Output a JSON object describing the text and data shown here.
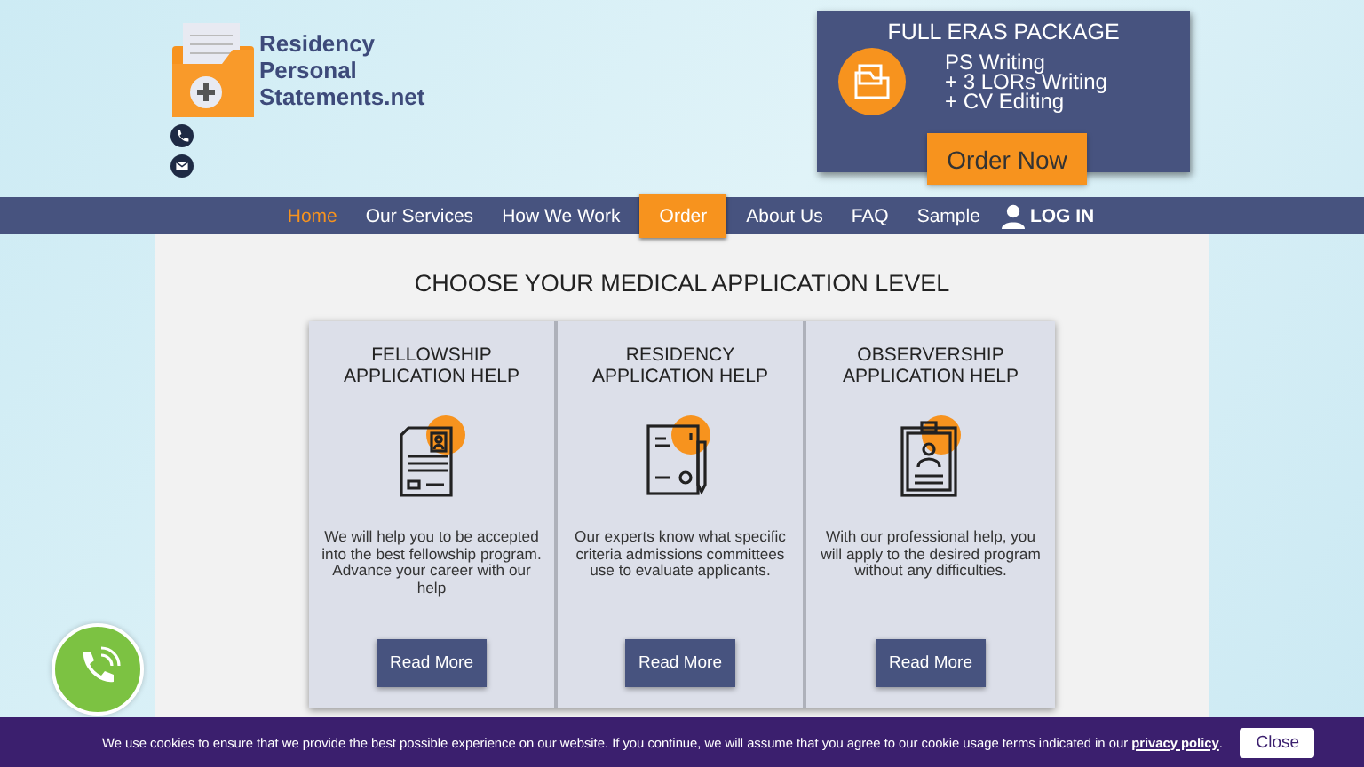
{
  "logo": {
    "lines": [
      "Residency",
      "Personal",
      "Statements.net"
    ]
  },
  "package": {
    "title": "FULL ERAS PACKAGE",
    "items": [
      "PS Writing",
      "+ 3 LORs Writing",
      "+ CV Editing"
    ],
    "button": "Order Now"
  },
  "nav": [
    {
      "label": "Home",
      "kind": "link",
      "selected": true
    },
    {
      "label": "Our Services",
      "kind": "link",
      "selected": false
    },
    {
      "label": "How We Work",
      "kind": "link",
      "selected": false
    },
    {
      "label": "Order",
      "kind": "highlight",
      "selected": false
    },
    {
      "label": "About Us",
      "kind": "link",
      "selected": false
    },
    {
      "label": "FAQ",
      "kind": "link",
      "selected": false
    },
    {
      "label": "Sample",
      "kind": "link",
      "selected": false
    },
    {
      "label": "LOG IN",
      "kind": "login",
      "selected": false
    }
  ],
  "heading": "CHOOSE YOUR MEDICAL APPLICATION LEVEL",
  "cards": [
    {
      "title": [
        "FELLOWSHIP",
        "APPLICATION HELP"
      ],
      "kind": "resume",
      "text": "We will help you to be accepted into the best fellowship program. Advance your career with our help",
      "button": "Read More"
    },
    {
      "title": [
        "RESIDENCY",
        "APPLICATION HELP"
      ],
      "kind": "contract",
      "text": "Our experts know what specific criteria admissions committees use to evaluate applicants.",
      "button": "Read More"
    },
    {
      "title": [
        "OBSERVERSHIP",
        "APPLICATION HELP"
      ],
      "kind": "clipboard",
      "text": "With our professional help, you will apply to the desired program without any difficulties.",
      "button": "Read More"
    }
  ],
  "cookie": {
    "text": "We use cookies to ensure that we provide the best possible experience on our website. If you continue, we will assume that you agree to our cookie usage terms indicated in our ",
    "link": "privacy policy",
    "after": ".",
    "button": "Close"
  }
}
